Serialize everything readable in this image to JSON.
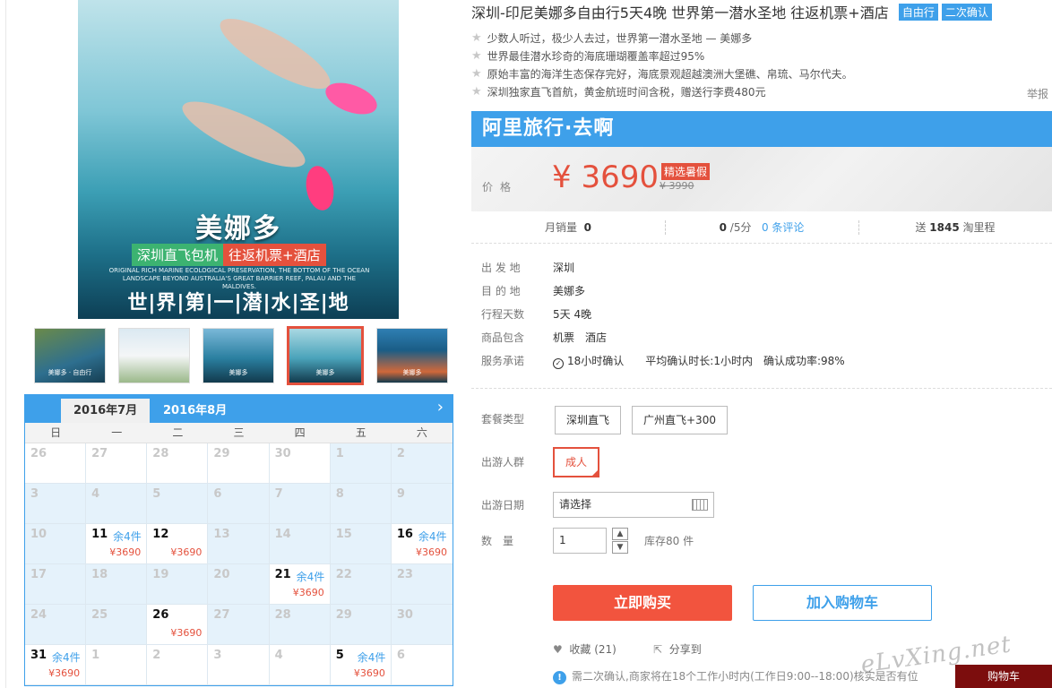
{
  "gallery": {
    "main_title": "美娜多",
    "badge_left": "深圳直飞包机",
    "badge_right": "往返机票+酒店",
    "english_text": "ORIGINAL RICH MARINE ECOLOGICAL PRESERVATION, THE BOTTOM OF THE OCEAN LANDSCAPE BEYOND AUSTRALIA'S GREAT BARRIER REEF, PALAU AND THE MALDIVES.",
    "slogan": "世|界|第|一|潜|水|圣|地",
    "thumbs": [
      {
        "label": "美娜多 · 自由行"
      },
      {
        "label": ""
      },
      {
        "label": "美娜多"
      },
      {
        "label": "美娜多",
        "active": true
      },
      {
        "label": "美娜多"
      }
    ]
  },
  "calendar": {
    "tab_current": "2016年7月",
    "tab_next": "2016年8月",
    "next_icon": "chevron-right-icon",
    "weekdays": [
      "日",
      "一",
      "二",
      "三",
      "四",
      "五",
      "六"
    ],
    "cells": [
      {
        "d": "26"
      },
      {
        "d": "27"
      },
      {
        "d": "28"
      },
      {
        "d": "29"
      },
      {
        "d": "30"
      },
      {
        "d": "1",
        "mute": true
      },
      {
        "d": "2",
        "mute": true
      },
      {
        "d": "3",
        "mute": true
      },
      {
        "d": "4",
        "mute": true
      },
      {
        "d": "5",
        "mute": true
      },
      {
        "d": "6",
        "mute": true
      },
      {
        "d": "7",
        "mute": true
      },
      {
        "d": "8",
        "mute": true
      },
      {
        "d": "9",
        "mute": true
      },
      {
        "d": "10",
        "mute": true
      },
      {
        "d": "11",
        "on": true,
        "rem": "余4件",
        "pr": "¥3690"
      },
      {
        "d": "12",
        "on": true,
        "pr": "¥3690"
      },
      {
        "d": "13",
        "mute": true
      },
      {
        "d": "14",
        "mute": true
      },
      {
        "d": "15",
        "mute": true
      },
      {
        "d": "16",
        "on": true,
        "rem": "余4件",
        "pr": "¥3690"
      },
      {
        "d": "17",
        "mute": true
      },
      {
        "d": "18",
        "mute": true
      },
      {
        "d": "19",
        "mute": true
      },
      {
        "d": "20",
        "mute": true
      },
      {
        "d": "21",
        "on": true,
        "rem": "余4件",
        "pr": "¥3690"
      },
      {
        "d": "22",
        "mute": true
      },
      {
        "d": "23",
        "mute": true
      },
      {
        "d": "24",
        "mute": true
      },
      {
        "d": "25",
        "mute": true
      },
      {
        "d": "26",
        "on": true,
        "pr": "¥3690"
      },
      {
        "d": "27",
        "mute": true
      },
      {
        "d": "28",
        "mute": true
      },
      {
        "d": "29",
        "mute": true
      },
      {
        "d": "30",
        "mute": true
      },
      {
        "d": "31",
        "on": true,
        "rem": "余4件",
        "pr": "¥3690"
      },
      {
        "d": "1"
      },
      {
        "d": "2"
      },
      {
        "d": "3"
      },
      {
        "d": "4"
      },
      {
        "d": "5",
        "on": true,
        "rem": "余4件",
        "pr": "¥3690"
      },
      {
        "d": "6"
      }
    ]
  },
  "product": {
    "title": "深圳-印尼美娜多自由行5天4晚 世界第一潜水圣地 往返机票+酒店",
    "tags": [
      "自由行",
      "二次确认"
    ],
    "points": [
      "少数人听过，极少人去过，世界第一潜水圣地 — 美娜多",
      "世界最佳潜水珍奇的海底珊瑚覆盖率超过95%",
      "原始丰富的海洋生态保存完好，海底景观超越澳洲大堡礁、帛琉、马尔代夫。",
      "深圳独家直飞首航，黄金航班时间含税，赠送行李费480元"
    ],
    "report": "举报",
    "banner": "阿里旅行·去啊",
    "price_label": "价格",
    "price": "¥ 3690",
    "price_tag": "精选暑假",
    "old_price": "¥ 3990",
    "stats": {
      "sales_label": "月销量",
      "sales_value": "0",
      "score_value": "0",
      "score_suffix": "/5分",
      "reviews": "0 条评论",
      "miles_prefix": "送",
      "miles_value": "1845",
      "miles_suffix": "淘里程"
    },
    "details": [
      {
        "k": "出 发 地",
        "v": [
          "深圳"
        ]
      },
      {
        "k": "目 的 地",
        "v": [
          "美娜多"
        ]
      },
      {
        "k": "行程天数",
        "v": [
          "5天 4晚"
        ]
      },
      {
        "k": "商品包含",
        "v": [
          "机票",
          "酒店"
        ]
      }
    ],
    "service": {
      "k": "服务承诺",
      "items": [
        "18小时确认",
        "平均确认时长:1小时内",
        "确认成功率:98%"
      ]
    }
  },
  "options": {
    "package_label": "套餐类型",
    "packages": [
      "深圳直飞",
      "广州直飞+300"
    ],
    "crowd_label": "出游人群",
    "crowd": "成人",
    "date_label": "出游日期",
    "date_value": "请选择",
    "qty_label": "数　量",
    "qty_value": "1",
    "stock": "库存80 件"
  },
  "actions": {
    "buy": "立即购买",
    "cart": "加入购物车",
    "favorite": "收藏 (21)",
    "share": "分享到",
    "notice": "需二次确认,商家将在18个工作小时内(工作日9:00--18:00)核实是否有位"
  },
  "overlay": {
    "watermark": "eLvXing.net",
    "cart_float": "购物车"
  },
  "colors": {
    "accent_blue": "#3ea0ea",
    "accent_red": "#f2543e"
  }
}
